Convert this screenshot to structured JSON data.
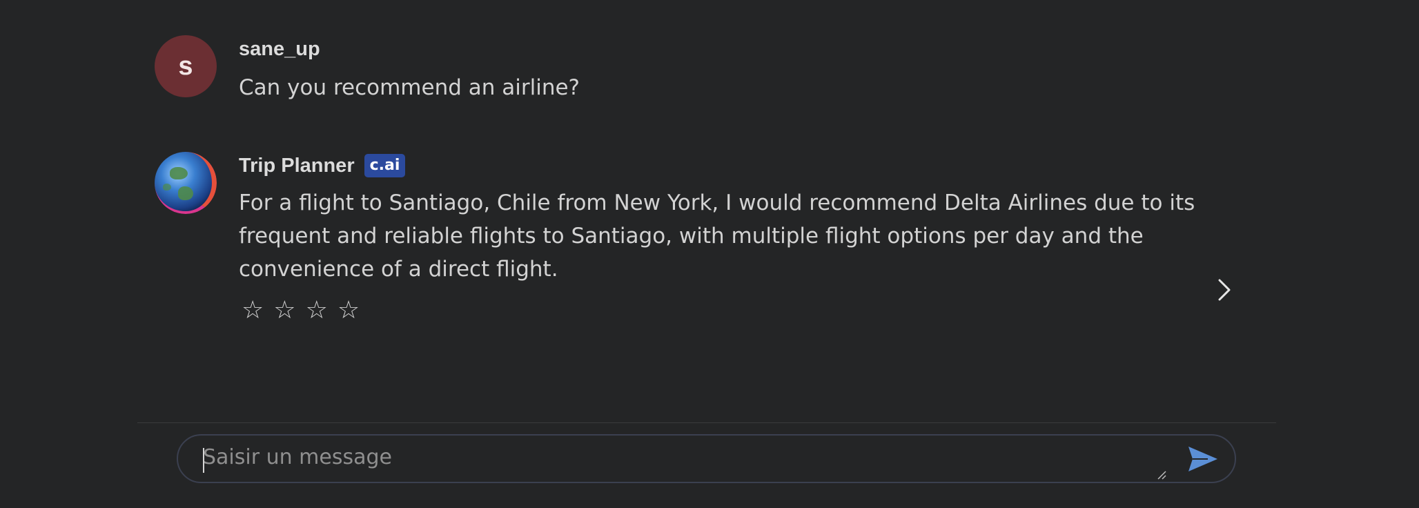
{
  "messages": [
    {
      "author": "sane_up",
      "avatar_letter": "s",
      "text": "Can you recommend an airline?"
    },
    {
      "author": "Trip Planner",
      "badge": "c.ai",
      "avatar_icon": "globe-avatar",
      "text": "For a flight to Santiago, Chile from New York, I would recommend Delta Airlines due to its\nfrequent and reliable flights to Santiago, with multiple flight options per day and the\nconvenience of a direct flight.",
      "rating": {
        "max": 4,
        "value": 0,
        "star_glyph": "☆"
      }
    }
  ],
  "composer": {
    "placeholder": "Saisir un message",
    "value": ""
  },
  "icons": {
    "next": "chevron-right-icon",
    "send": "send-icon"
  },
  "colors": {
    "background": "#242526",
    "user_avatar": "#6b2f33",
    "badge": "#2b4a9e",
    "send_accent": "#5b8fd6",
    "input_border": "#3b4050"
  }
}
